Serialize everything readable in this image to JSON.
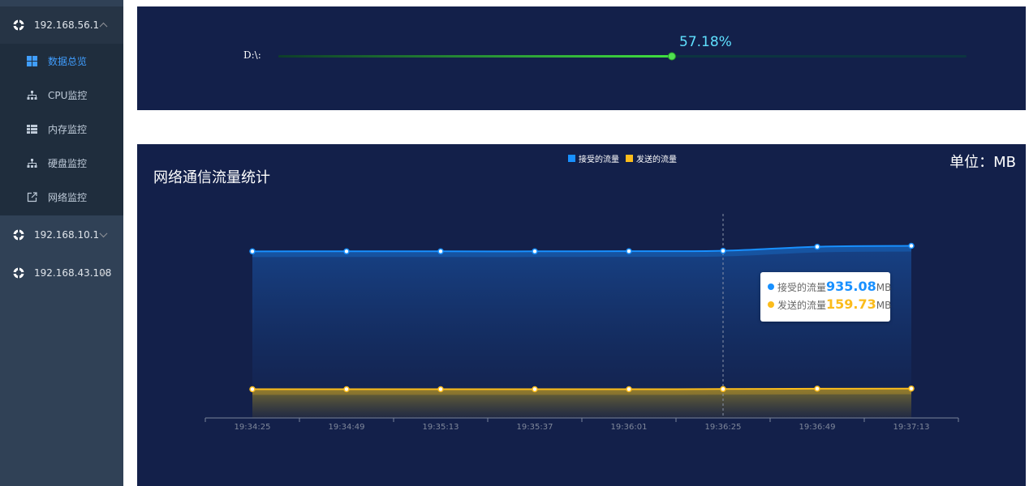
{
  "sidebar": {
    "hosts": [
      {
        "label": "192.168.56.1",
        "expanded": true,
        "icon": "target-icon"
      },
      {
        "label": "192.168.10.1",
        "expanded": false,
        "icon": "target-icon"
      },
      {
        "label": "192.168.43.108",
        "expanded": false,
        "icon": "target-icon"
      }
    ],
    "items": [
      {
        "label": "数据总览",
        "icon": "grid-icon",
        "active": true
      },
      {
        "label": "CPU监控",
        "icon": "sitemap-icon",
        "active": false
      },
      {
        "label": "内存监控",
        "icon": "table-icon",
        "active": false
      },
      {
        "label": "硬盘监控",
        "icon": "sitemap-icon",
        "active": false
      },
      {
        "label": "网络监控",
        "icon": "external-link-icon",
        "active": false
      }
    ]
  },
  "disk": {
    "label": "D:\\:",
    "percent_text": "57.18%",
    "percent": 57.18
  },
  "network": {
    "title": "网络通信流量统计",
    "unit": "单位：MB",
    "legend": [
      {
        "label": "接受的流量",
        "color": "#1890ff"
      },
      {
        "label": "发送的流量",
        "color": "#fbbc1c"
      }
    ],
    "tooltip": {
      "rows": [
        {
          "label": "接受的流量",
          "value": "935.08",
          "unit": "MB",
          "color": "#1890ff"
        },
        {
          "label": "发送的流量",
          "value": "159.73",
          "unit": "MB",
          "color": "#fbbc1c"
        }
      ]
    }
  },
  "chart_data": {
    "type": "area",
    "title": "网络通信流量统计",
    "categories": [
      "19:34:25",
      "19:34:49",
      "19:35:13",
      "19:35:37",
      "19:36:01",
      "19:36:25",
      "19:36:49",
      "19:37:13"
    ],
    "series": [
      {
        "name": "接受的流量",
        "color": "#1890ff",
        "values": [
          905,
          905,
          905,
          905,
          906,
          908,
          930,
          935.08
        ]
      },
      {
        "name": "发送的流量",
        "color": "#fbbc1c",
        "values": [
          156,
          156,
          156,
          156,
          156,
          157,
          159,
          159.73
        ]
      }
    ],
    "ylim": [
      0,
      1100
    ],
    "highlighted_category": "19:36:25",
    "grid": false,
    "legend_position": "top-center"
  }
}
